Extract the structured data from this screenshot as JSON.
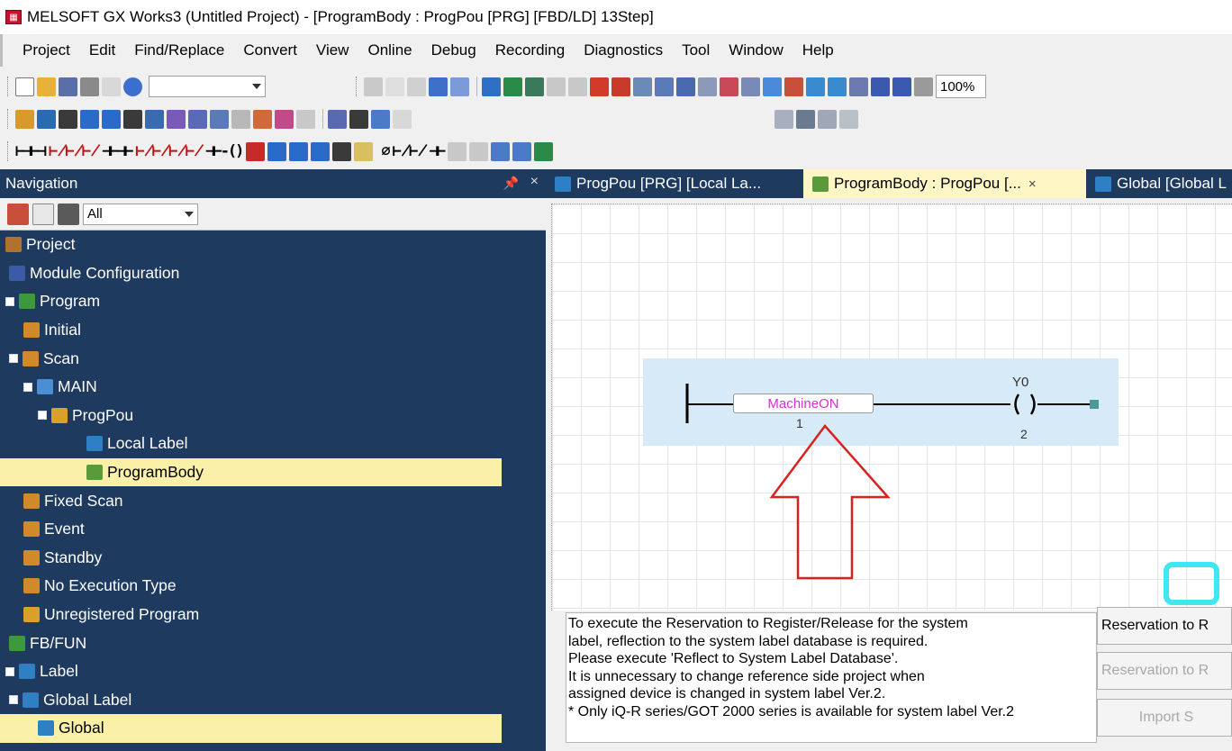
{
  "window": {
    "title": "MELSOFT GX Works3 (Untitled Project) - [ProgramBody : ProgPou [PRG] [FBD/LD] 13Step]"
  },
  "menu": [
    "Project",
    "Edit",
    "Find/Replace",
    "Convert",
    "View",
    "Online",
    "Debug",
    "Recording",
    "Diagnostics",
    "Tool",
    "Window",
    "Help"
  ],
  "toolbar": {
    "zoom": "100%"
  },
  "navigation": {
    "title": "Navigation",
    "filter": "All",
    "tree": [
      {
        "label": "Project",
        "level": 0,
        "expander": false,
        "icon_color": "#b0722c",
        "selected": false
      },
      {
        "label": "Module Configuration",
        "level": 1,
        "expander": false,
        "icon_color": "#3b5ba8",
        "selected": false
      },
      {
        "label": "Program",
        "level": 0,
        "expander": true,
        "icon_color": "#3c9a3c",
        "selected": false
      },
      {
        "label": "Initial",
        "level": 2,
        "expander": false,
        "icon_color": "#d08a2a",
        "selected": false
      },
      {
        "label": "Scan",
        "level": 1,
        "expander": true,
        "icon_color": "#d08a2a",
        "selected": false
      },
      {
        "label": "MAIN",
        "level": 2,
        "expander": true,
        "icon_color": "#4a8fd4",
        "selected": false
      },
      {
        "label": "ProgPou",
        "level": 3,
        "expander": true,
        "icon_color": "#d9a02a",
        "selected": false
      },
      {
        "label": "Local Label",
        "level": 5,
        "expander": false,
        "icon_color": "#2f7fc4",
        "selected": false
      },
      {
        "label": "ProgramBody",
        "level": 5,
        "expander": false,
        "icon_color": "#5a9a3a",
        "selected": true
      },
      {
        "label": "Fixed Scan",
        "level": 2,
        "expander": false,
        "icon_color": "#d08a2a",
        "selected": false
      },
      {
        "label": "Event",
        "level": 2,
        "expander": false,
        "icon_color": "#d08a2a",
        "selected": false
      },
      {
        "label": "Standby",
        "level": 2,
        "expander": false,
        "icon_color": "#d08a2a",
        "selected": false
      },
      {
        "label": "No Execution Type",
        "level": 2,
        "expander": false,
        "icon_color": "#d08a2a",
        "selected": false
      },
      {
        "label": "Unregistered Program",
        "level": 2,
        "expander": false,
        "icon_color": "#d9a02a",
        "selected": false
      },
      {
        "label": "FB/FUN",
        "level": 1,
        "expander": false,
        "icon_color": "#3c9a3c",
        "selected": false
      },
      {
        "label": "Label",
        "level": 0,
        "expander": true,
        "icon_color": "#2f7fc4",
        "selected": false
      },
      {
        "label": "Global Label",
        "level": 1,
        "expander": true,
        "icon_color": "#2f7fc4",
        "selected": false
      },
      {
        "label": "Global",
        "level": 3,
        "expander": false,
        "icon_color": "#2f7fc4",
        "selected": true
      }
    ]
  },
  "tabs": [
    {
      "label": "ProgPou [PRG] [Local La...",
      "active": false,
      "closable": false,
      "icon_color": "#2f7fc4"
    },
    {
      "label": "ProgramBody : ProgPou [...",
      "active": true,
      "closable": true,
      "icon_color": "#5a9a3a"
    },
    {
      "label": "Global [Global L",
      "active": false,
      "closable": false,
      "icon_color": "#2f7fc4"
    }
  ],
  "editor": {
    "contact_label": "MachineON",
    "contact_number": "1",
    "coil_device": "Y0",
    "coil_number": "2"
  },
  "info": {
    "lines": [
      "To execute the Reservation to Register/Release for the system",
      "label, reflection to the system label database is required.",
      "Please execute 'Reflect to System Label Database'.",
      "It is unnecessary to change reference side project when",
      "assigned device is changed in system label Ver.2.",
      "* Only iQ-R series/GOT 2000 series is available for system label Ver.2"
    ],
    "buttons": [
      {
        "label": "Reservation to R",
        "enabled": true
      },
      {
        "label": "Reservation to R",
        "enabled": false
      },
      {
        "label": "Import S",
        "enabled": false
      }
    ]
  },
  "colors": {
    "nav_bg": "#1e3a5f",
    "selection": "#fbf0a7",
    "contact_text": "#d531cf",
    "highlight": "#3fe7ef",
    "arrow": "#d9221f"
  }
}
